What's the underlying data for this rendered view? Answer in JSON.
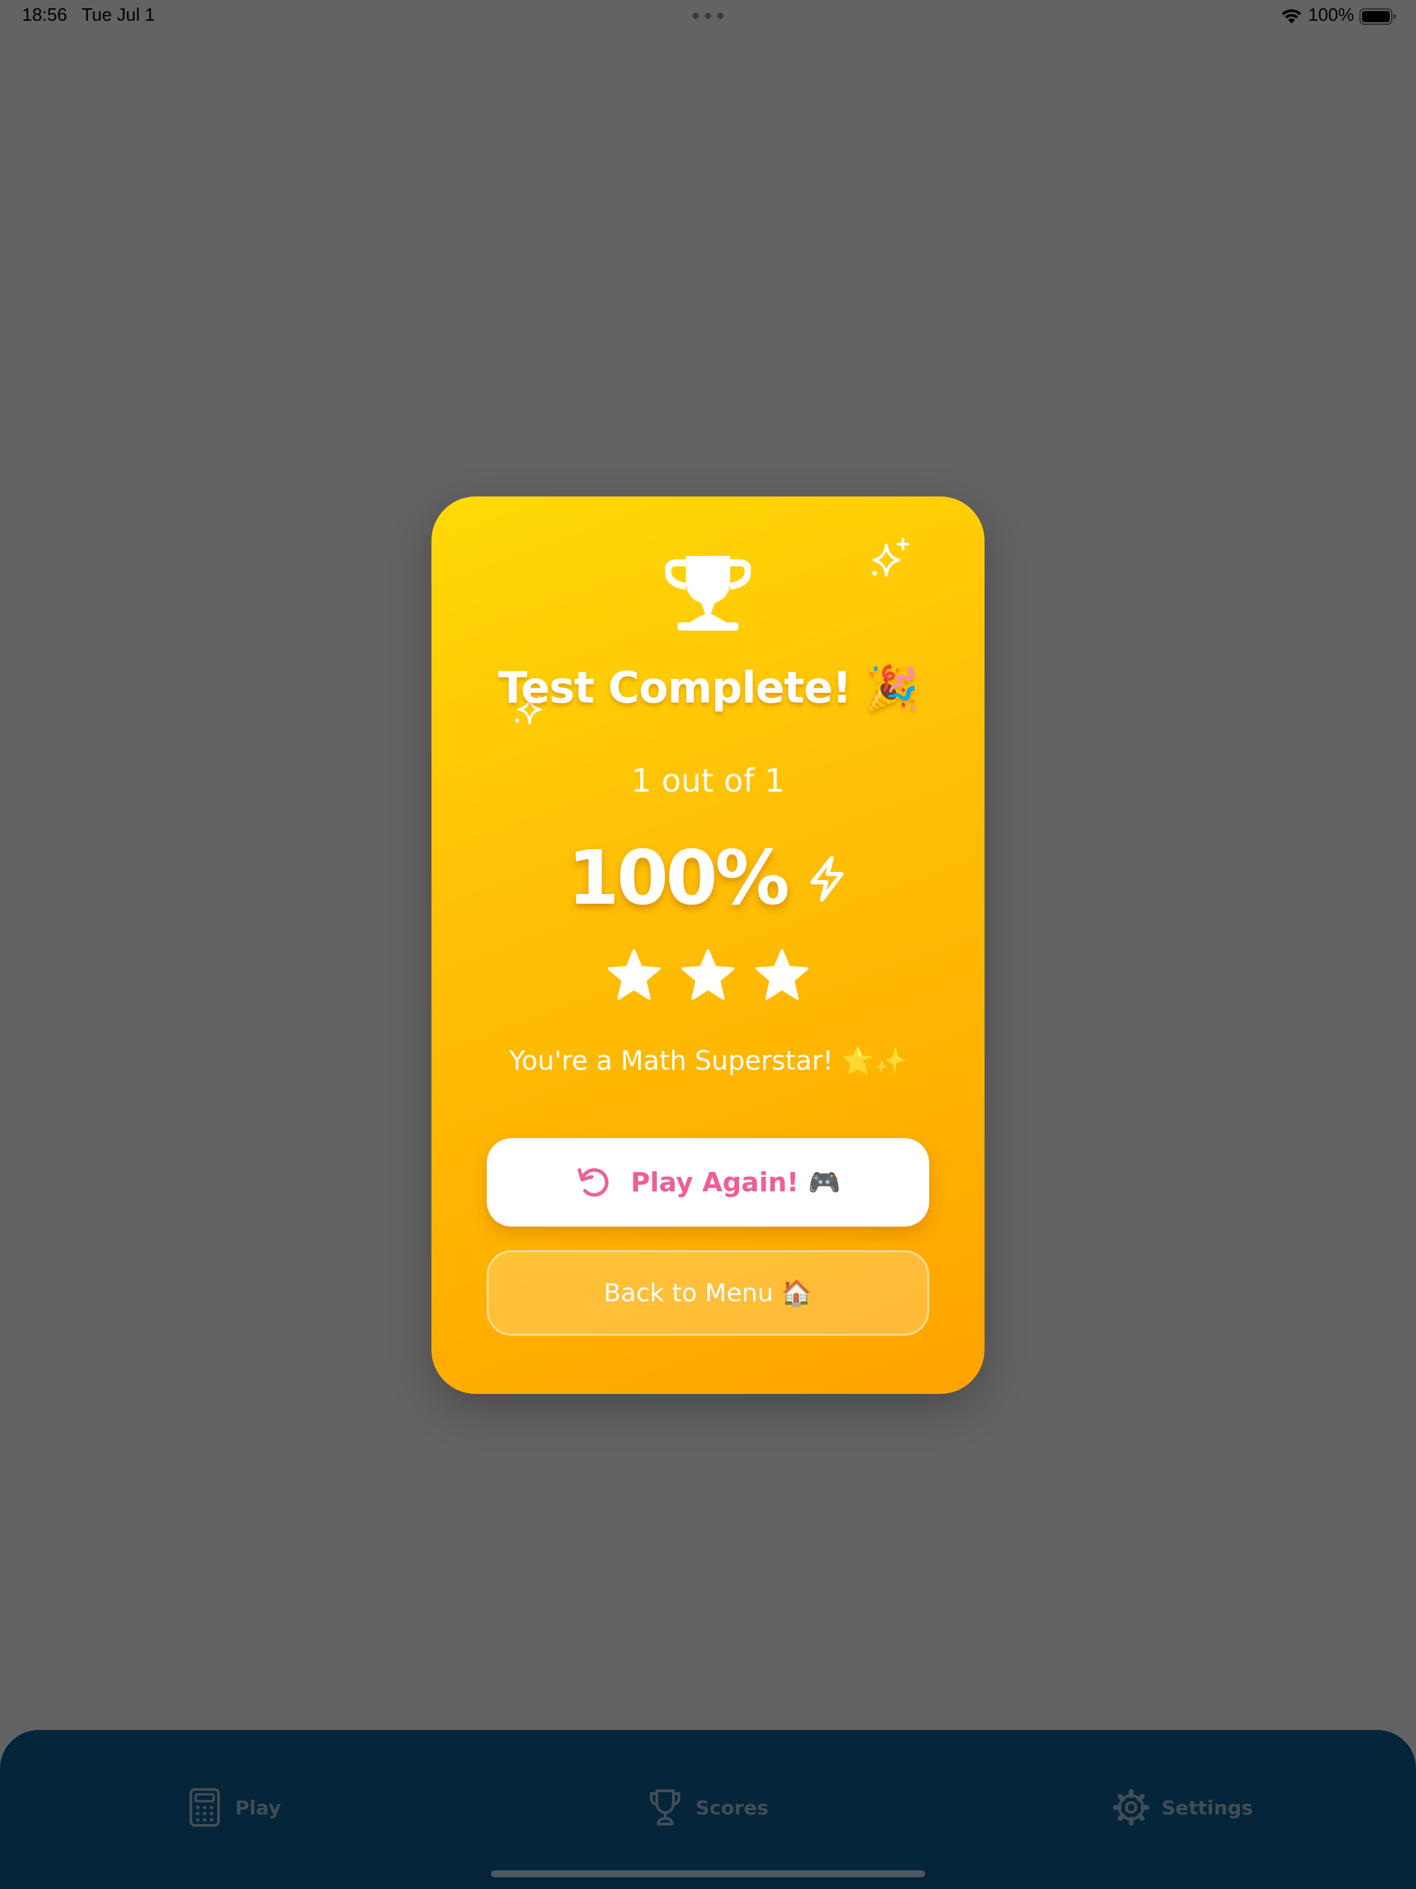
{
  "status_bar": {
    "time": "18:56",
    "date": "Tue Jul 1",
    "battery_percent": "100%",
    "wifi_icon": "wifi-icon",
    "battery_icon": "battery-icon",
    "multitasking_icon": "more-dots-icon"
  },
  "result_card": {
    "title": "Test Complete! 🎉",
    "score_text": "1 out of 1",
    "percentage": "100%",
    "stars_earned": 3,
    "stars_total": 3,
    "message": "You're a Math Superstar! 🌟✨",
    "icons": [
      "trophy-icon",
      "sparkle-icon",
      "lightning-bolt-icon",
      "star-icon",
      "replay-icon"
    ],
    "gradient_colors": [
      "#ffda05",
      "#ffa200"
    ]
  },
  "buttons": {
    "play_again_label": "Play Again! 🎮",
    "back_to_menu_label": "Back to Menu 🏠"
  },
  "tab_bar": {
    "tabs": [
      {
        "label": "Play",
        "icon": "calculator-icon"
      },
      {
        "label": "Scores",
        "icon": "trophy-icon"
      },
      {
        "label": "Settings",
        "icon": "gear-icon"
      }
    ]
  },
  "colors": {
    "overlay_background": "#636363",
    "card_gradient_start": "#ffda05",
    "card_gradient_end": "#ffa200",
    "play_again_text": "#ef5e97",
    "tab_bar_background": "#05253b",
    "tab_inactive": "#414d56"
  }
}
